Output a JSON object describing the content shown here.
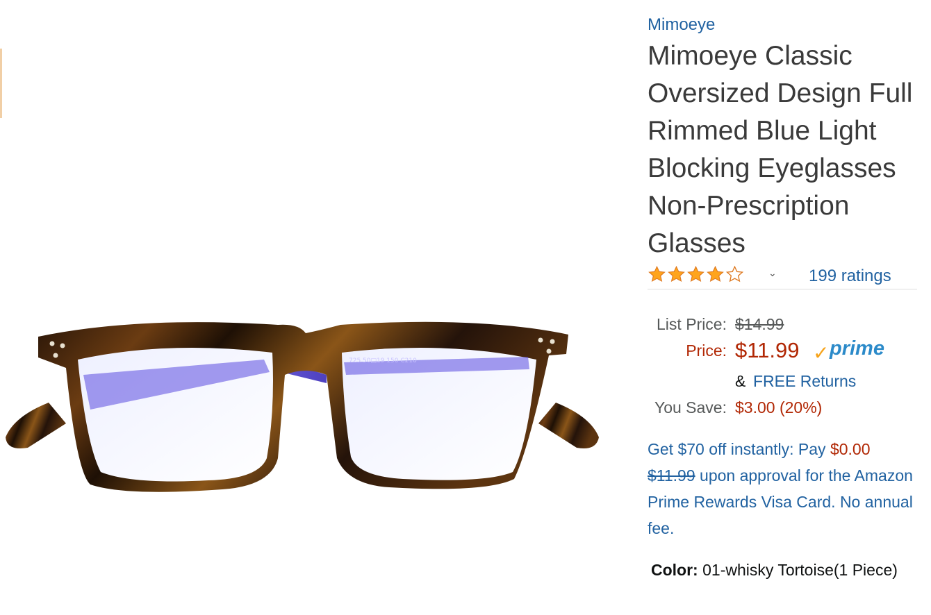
{
  "product": {
    "brand": "Mimoeye",
    "title": "Mimoeye Classic Oversized Design Full Rimmed Blue Light Blocking Eyeglasses Non-Prescription Glasses",
    "image_frame_text": "725 50□19 150 C210"
  },
  "rating": {
    "stars": 4,
    "out_of": 5,
    "count_text": "199 ratings"
  },
  "pricing": {
    "list_label": "List Price:",
    "list_value": "$14.99",
    "price_label": "Price:",
    "price_value": "$11.99",
    "prime_check": "✓",
    "prime_label": "prime",
    "amp": "&",
    "free_returns": "FREE Returns",
    "save_label": "You Save:",
    "save_value": "$3.00 (20%)"
  },
  "promo": {
    "lead": "Get $70 off instantly: Pay ",
    "pay_amount": "$0.00",
    "struck_price": "$11.99",
    "tail": " upon approval for the Amazon Prime Rewards Visa Card. No annual fee."
  },
  "variation": {
    "label": "Color:",
    "value": " 01-whisky Tortoise(1 Piece)"
  },
  "colors": {
    "link": "#2162a1",
    "price": "#b12704",
    "star": "#ffa41c",
    "prime_blue": "#2b8ac9",
    "prime_check": "#f6a31a"
  },
  "icons": [
    "star-icon",
    "chevron-down-icon",
    "prime-check-icon"
  ]
}
